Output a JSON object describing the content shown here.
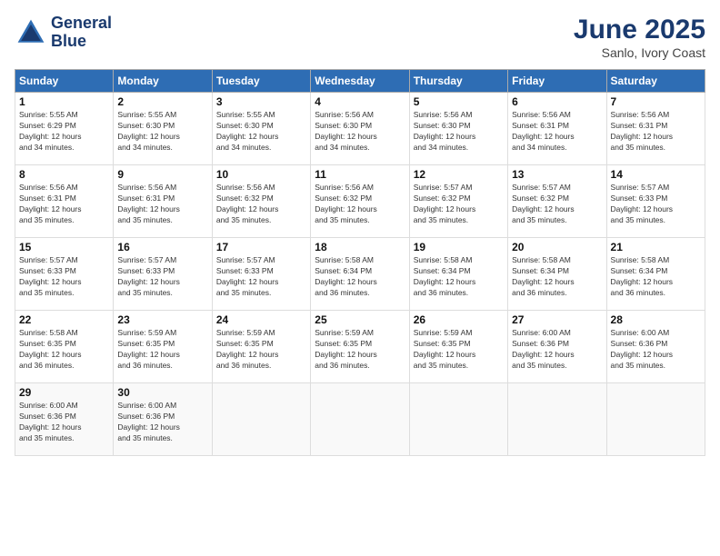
{
  "logo": {
    "line1": "General",
    "line2": "Blue"
  },
  "title": "June 2025",
  "location": "Sanlo, Ivory Coast",
  "headers": [
    "Sunday",
    "Monday",
    "Tuesday",
    "Wednesday",
    "Thursday",
    "Friday",
    "Saturday"
  ],
  "weeks": [
    [
      {
        "day": "1",
        "info": "Sunrise: 5:55 AM\nSunset: 6:29 PM\nDaylight: 12 hours\nand 34 minutes."
      },
      {
        "day": "2",
        "info": "Sunrise: 5:55 AM\nSunset: 6:30 PM\nDaylight: 12 hours\nand 34 minutes."
      },
      {
        "day": "3",
        "info": "Sunrise: 5:55 AM\nSunset: 6:30 PM\nDaylight: 12 hours\nand 34 minutes."
      },
      {
        "day": "4",
        "info": "Sunrise: 5:56 AM\nSunset: 6:30 PM\nDaylight: 12 hours\nand 34 minutes."
      },
      {
        "day": "5",
        "info": "Sunrise: 5:56 AM\nSunset: 6:30 PM\nDaylight: 12 hours\nand 34 minutes."
      },
      {
        "day": "6",
        "info": "Sunrise: 5:56 AM\nSunset: 6:31 PM\nDaylight: 12 hours\nand 34 minutes."
      },
      {
        "day": "7",
        "info": "Sunrise: 5:56 AM\nSunset: 6:31 PM\nDaylight: 12 hours\nand 35 minutes."
      }
    ],
    [
      {
        "day": "8",
        "info": "Sunrise: 5:56 AM\nSunset: 6:31 PM\nDaylight: 12 hours\nand 35 minutes."
      },
      {
        "day": "9",
        "info": "Sunrise: 5:56 AM\nSunset: 6:31 PM\nDaylight: 12 hours\nand 35 minutes."
      },
      {
        "day": "10",
        "info": "Sunrise: 5:56 AM\nSunset: 6:32 PM\nDaylight: 12 hours\nand 35 minutes."
      },
      {
        "day": "11",
        "info": "Sunrise: 5:56 AM\nSunset: 6:32 PM\nDaylight: 12 hours\nand 35 minutes."
      },
      {
        "day": "12",
        "info": "Sunrise: 5:57 AM\nSunset: 6:32 PM\nDaylight: 12 hours\nand 35 minutes."
      },
      {
        "day": "13",
        "info": "Sunrise: 5:57 AM\nSunset: 6:32 PM\nDaylight: 12 hours\nand 35 minutes."
      },
      {
        "day": "14",
        "info": "Sunrise: 5:57 AM\nSunset: 6:33 PM\nDaylight: 12 hours\nand 35 minutes."
      }
    ],
    [
      {
        "day": "15",
        "info": "Sunrise: 5:57 AM\nSunset: 6:33 PM\nDaylight: 12 hours\nand 35 minutes."
      },
      {
        "day": "16",
        "info": "Sunrise: 5:57 AM\nSunset: 6:33 PM\nDaylight: 12 hours\nand 35 minutes."
      },
      {
        "day": "17",
        "info": "Sunrise: 5:57 AM\nSunset: 6:33 PM\nDaylight: 12 hours\nand 35 minutes."
      },
      {
        "day": "18",
        "info": "Sunrise: 5:58 AM\nSunset: 6:34 PM\nDaylight: 12 hours\nand 36 minutes."
      },
      {
        "day": "19",
        "info": "Sunrise: 5:58 AM\nSunset: 6:34 PM\nDaylight: 12 hours\nand 36 minutes."
      },
      {
        "day": "20",
        "info": "Sunrise: 5:58 AM\nSunset: 6:34 PM\nDaylight: 12 hours\nand 36 minutes."
      },
      {
        "day": "21",
        "info": "Sunrise: 5:58 AM\nSunset: 6:34 PM\nDaylight: 12 hours\nand 36 minutes."
      }
    ],
    [
      {
        "day": "22",
        "info": "Sunrise: 5:58 AM\nSunset: 6:35 PM\nDaylight: 12 hours\nand 36 minutes."
      },
      {
        "day": "23",
        "info": "Sunrise: 5:59 AM\nSunset: 6:35 PM\nDaylight: 12 hours\nand 36 minutes."
      },
      {
        "day": "24",
        "info": "Sunrise: 5:59 AM\nSunset: 6:35 PM\nDaylight: 12 hours\nand 36 minutes."
      },
      {
        "day": "25",
        "info": "Sunrise: 5:59 AM\nSunset: 6:35 PM\nDaylight: 12 hours\nand 36 minutes."
      },
      {
        "day": "26",
        "info": "Sunrise: 5:59 AM\nSunset: 6:35 PM\nDaylight: 12 hours\nand 35 minutes."
      },
      {
        "day": "27",
        "info": "Sunrise: 6:00 AM\nSunset: 6:36 PM\nDaylight: 12 hours\nand 35 minutes."
      },
      {
        "day": "28",
        "info": "Sunrise: 6:00 AM\nSunset: 6:36 PM\nDaylight: 12 hours\nand 35 minutes."
      }
    ],
    [
      {
        "day": "29",
        "info": "Sunrise: 6:00 AM\nSunset: 6:36 PM\nDaylight: 12 hours\nand 35 minutes."
      },
      {
        "day": "30",
        "info": "Sunrise: 6:00 AM\nSunset: 6:36 PM\nDaylight: 12 hours\nand 35 minutes."
      },
      {
        "day": "",
        "info": ""
      },
      {
        "day": "",
        "info": ""
      },
      {
        "day": "",
        "info": ""
      },
      {
        "day": "",
        "info": ""
      },
      {
        "day": "",
        "info": ""
      }
    ]
  ]
}
